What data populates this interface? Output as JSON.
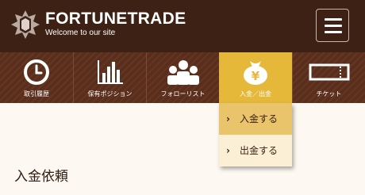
{
  "header": {
    "brand_name": "FORTUNETRADE",
    "tagline": "Welcome to our site",
    "logo_icon": "compass-star-icon",
    "menu_icon": "hamburger-menu-icon"
  },
  "nav": {
    "items": [
      {
        "label": "取引履歴",
        "icon": "clock-icon"
      },
      {
        "label": "保有ポジション",
        "icon": "bar-chart-icon"
      },
      {
        "label": "フォローリスト",
        "icon": "people-icon"
      },
      {
        "label": "入金／出金",
        "icon": "yen-bag-icon",
        "active": true
      },
      {
        "label": "チケット",
        "icon": "ticket-icon"
      }
    ]
  },
  "dropdown": {
    "items": [
      {
        "label": "入金する"
      },
      {
        "label": "出金する"
      }
    ]
  },
  "page": {
    "title": "入金依頼"
  },
  "colors": {
    "header_bg": "#3e2115",
    "nav_bg": "#5a2e1b",
    "accent": "#e6b83a",
    "page_bg": "#fdf9f2"
  }
}
